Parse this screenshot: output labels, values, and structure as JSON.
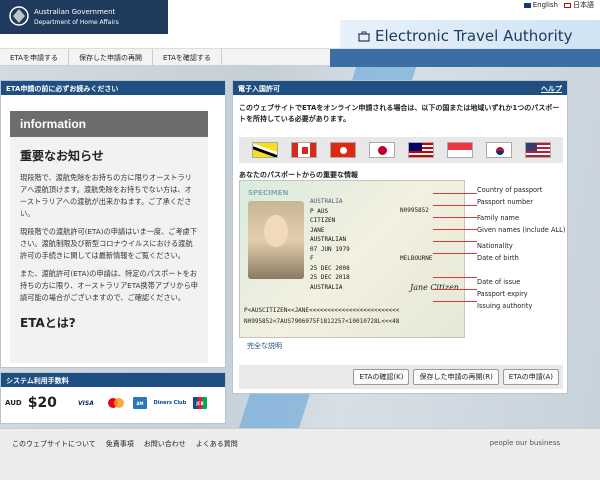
{
  "header": {
    "gov_line1": "Australian Government",
    "gov_line2": "Department of Home Affairs",
    "lang_en": "English",
    "lang_ja": "日本語",
    "app_title": "Electronic Travel Authority"
  },
  "nav": {
    "items": [
      "ETAを申請する",
      "保存した申請の再開",
      "ETAを確認する"
    ]
  },
  "left_panel": {
    "title": "ETA申請の前に必ずお読みください",
    "info_title": "information",
    "heading": "重要なお知らせ",
    "p1": "現段階で、渡航免除をお持ちの方に限りオーストラリアへ渡航頂けます。渡航免除をお持ちでない方は、オーストラリアへの渡航が出来かねます。ご了承ください。",
    "p2": "現段階での渡航許可(ETA)の申請はいま一度、ご考慮下さい。渡航制限及び新型コロナウイルスにおける渡航許可の手続きに関しては最新情報をご覧ください。",
    "p3": "また、渡航許可(ETA)の申請は、特定のパスポートをお持ちの方に限り、オーストラリアETA携帯アプリから申請可能の場合がございますので、ご確認ください。",
    "heading2": "ETAとは?"
  },
  "fee_panel": {
    "title": "システム利用手数料",
    "currency": "AUD",
    "amount": "$20",
    "cards": [
      "VISA",
      "Mastercard",
      "AMEX",
      "Diners Club",
      "JCB"
    ]
  },
  "right_panel": {
    "title": "電子入国許可",
    "help": "ヘルプ",
    "intro": "このウェブサイトでETAをオンライン申請される場合は、以下の国または地域いずれか1つのパスポートを所持している必要があります。",
    "flags": [
      "Brunei",
      "Canada",
      "Hong Kong",
      "Japan",
      "Malaysia",
      "Singapore",
      "Korea",
      "USA"
    ],
    "passport_info_label": "あなたのパスポートからの重要な情報",
    "passport": {
      "specimen": "SPECIMEN",
      "country_label": "AUSTRALIA",
      "doc_no": "N0995852",
      "type": "P  AUS",
      "surname": "CITIZEN",
      "given": "JANE",
      "nationality": "AUSTRALIAN",
      "dob": "07 JUN 1979",
      "sex": "F",
      "place": "MELBOURNE",
      "issue": "25 DEC 2008",
      "expiry": "25 DEC 2018",
      "authority": "AUSTRALIA",
      "signature": "Jane Citizen",
      "mrz1": "P<AUSCITIZEN<<JANE<<<<<<<<<<<<<<<<<<<<<<<<<",
      "mrz2": "N0995852<7AUS7906075F1812257<10010728L<<<48"
    },
    "field_labels": [
      "Country of passport",
      "Passport number",
      "Family name",
      "Given names (include ALL)",
      "Nationality",
      "Date of birth",
      "Date of issue",
      "Passport expiry",
      "Issuing authority"
    ],
    "explain_link": "完全な説明",
    "buttons": [
      "ETAの確認(K)",
      "保存した申請の再開(R)",
      "ETAの申請(A)"
    ]
  },
  "footer": {
    "links": [
      "このウェブサイトについて",
      "免責事項",
      "お問い合わせ",
      "よくある質問"
    ],
    "tagline": "people our business"
  },
  "colors": {
    "gov_navy": "#1e3a5c",
    "panel_head": "#1e4f80",
    "accent_blue": "#5aa0d8"
  }
}
